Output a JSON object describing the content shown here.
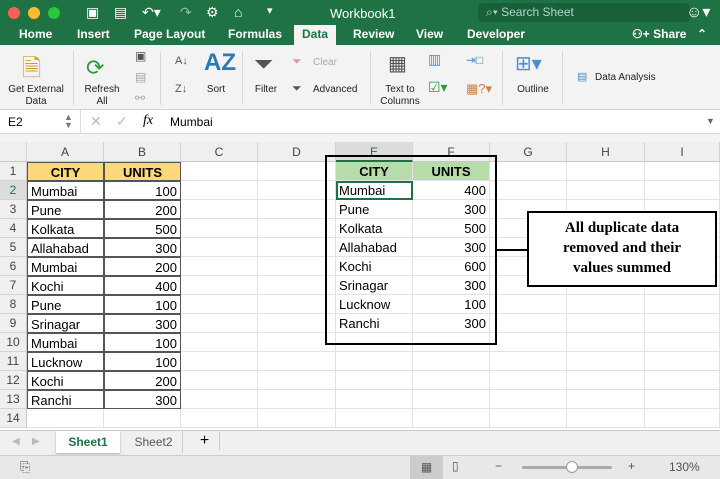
{
  "window": {
    "title": "Workbook1",
    "search_placeholder": "Search Sheet"
  },
  "tabs": [
    "Home",
    "Insert",
    "Page Layout",
    "Formulas",
    "Data",
    "Review",
    "View",
    "Developer"
  ],
  "active_tab": "Data",
  "share_label": "Share",
  "ribbon": {
    "get_external": "Get External",
    "get_external2": "Data",
    "refresh": "Refresh",
    "refresh2": "All",
    "sort": "Sort",
    "filter": "Filter",
    "clear": "Clear",
    "advanced": "Advanced",
    "text_to": "Text to",
    "columns": "Columns",
    "outline": "Outline",
    "data_analysis": "Data Analysis"
  },
  "formula_bar": {
    "name_box": "E2",
    "fx": "fx",
    "value": "Mumbai"
  },
  "columns": [
    "A",
    "B",
    "C",
    "D",
    "E",
    "F",
    "G",
    "H",
    "I"
  ],
  "rows": [
    "1",
    "2",
    "3",
    "4",
    "5",
    "6",
    "7",
    "8",
    "9",
    "10",
    "11",
    "12",
    "13",
    "14"
  ],
  "source": {
    "headers": [
      "CITY",
      "UNITS"
    ],
    "rows": [
      [
        "Mumbai",
        "100"
      ],
      [
        "Pune",
        "200"
      ],
      [
        "Kolkata",
        "500"
      ],
      [
        "Allahabad",
        "300"
      ],
      [
        "Mumbai",
        "200"
      ],
      [
        "Kochi",
        "400"
      ],
      [
        "Pune",
        "100"
      ],
      [
        "Srinagar",
        "300"
      ],
      [
        "Mumbai",
        "100"
      ],
      [
        "Lucknow",
        "100"
      ],
      [
        "Kochi",
        "200"
      ],
      [
        "Ranchi",
        "300"
      ]
    ]
  },
  "result": {
    "headers": [
      "CITY",
      "UNITS"
    ],
    "rows": [
      [
        "Mumbai",
        "400"
      ],
      [
        "Pune",
        "300"
      ],
      [
        "Kolkata",
        "500"
      ],
      [
        "Allahabad",
        "300"
      ],
      [
        "Kochi",
        "600"
      ],
      [
        "Srinagar",
        "300"
      ],
      [
        "Lucknow",
        "100"
      ],
      [
        "Ranchi",
        "300"
      ]
    ]
  },
  "annotation": [
    "All duplicate data",
    "removed and their",
    "values summed"
  ],
  "sheets": [
    "Sheet1",
    "Sheet2"
  ],
  "add_sheet": "+",
  "zoom": "130%",
  "zoom_fraction": 0.55,
  "colors": {
    "brand": "#1f7244",
    "source_header": "#fdd87a",
    "result_header": "#b6dcaa"
  }
}
